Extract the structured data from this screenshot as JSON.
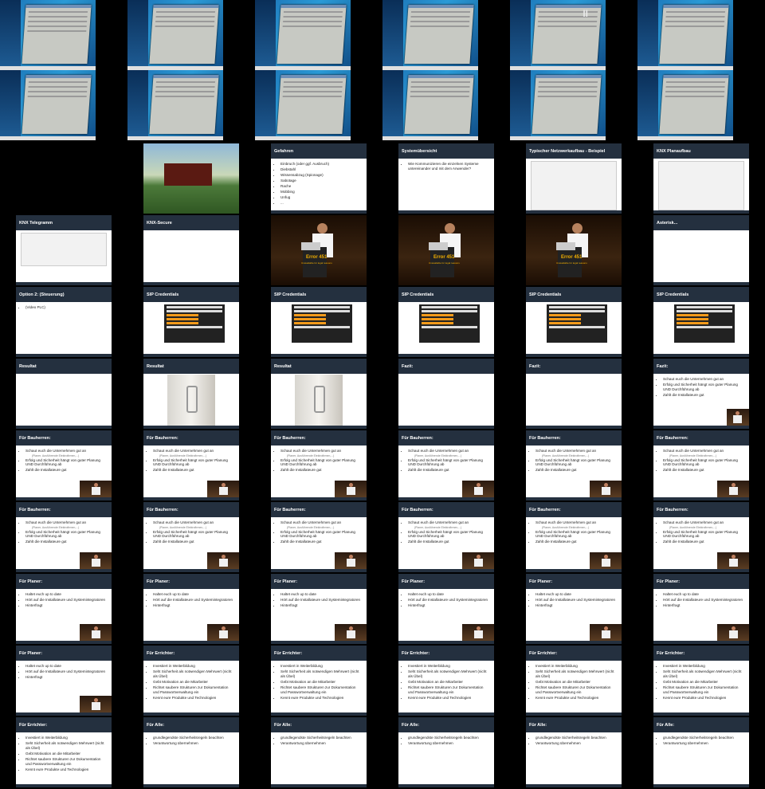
{
  "screens": {
    "pause_glyph": "II"
  },
  "slides": {
    "gefahren": {
      "title": "Gefahren",
      "items": [
        "Einbruch (oder ggf. Ausbruch)",
        "Diebstahl",
        "Wissensabzug (Spionage)",
        "Sabotage",
        "Rache",
        "Mobbing",
        "Unfug",
        "..."
      ]
    },
    "system": {
      "title": "Systemübersicht",
      "items": [
        "Wie Kommunizieren die einzelnen Systeme untereinander und mit dem Anwender?"
      ]
    },
    "netzwerk": {
      "title": "Typischer Netzwerkaufbau - Beispiel"
    },
    "knx_plan": {
      "title": "KNX Planaufbau"
    },
    "knx_telegramm": {
      "title": "KNX Telegramm"
    },
    "knx_secure": {
      "title": "KNX-Secure"
    },
    "error": {
      "code": "Error 451",
      "text": "Unavailable for legal reasons"
    },
    "asterisk": {
      "title": "Asterisk..."
    },
    "option2": {
      "title": "Option 2: (Steuerung)",
      "items": [
        "(Video PLC)"
      ]
    },
    "sip": {
      "title": "SIP Credentials"
    },
    "resultat": {
      "title": "Resultat"
    },
    "fazit": {
      "title": "Fazit:"
    },
    "bauherren": {
      "title": "Für Bauherren:",
      "items": [
        "Schaut euch die Unternehmen gut an",
        "Erfolg und Sicherheit hängt von guter Planung UND Durchführung ab",
        "Zahlt die Installateure gut"
      ],
      "sub": "(Planer, Ausführende Elektrofirmen,...)"
    },
    "planer": {
      "title": "Für Planer:",
      "items": [
        "Haltet euch up to date",
        "Hört auf die Installateure und Systemintegratoren",
        "Hinterfragt"
      ]
    },
    "errichter": {
      "title": "Für Errichter:",
      "items": [
        "Investiert in Weiterbildung",
        "Seht Sicherheit als notwendigen Mehrwert (nicht als Übel)",
        "Gebt Motivation an die Mitarbeiter",
        "Richtet saubere Strukturen zur Dokumentation und Passwortverwaltung ein",
        "Kennt eure Produkte und Technologien"
      ]
    },
    "alle": {
      "title": "Für Alle:",
      "items": [
        "grundlegendste Sicherheitsregeln beachten",
        "Verantwortung übernehmen"
      ]
    }
  }
}
